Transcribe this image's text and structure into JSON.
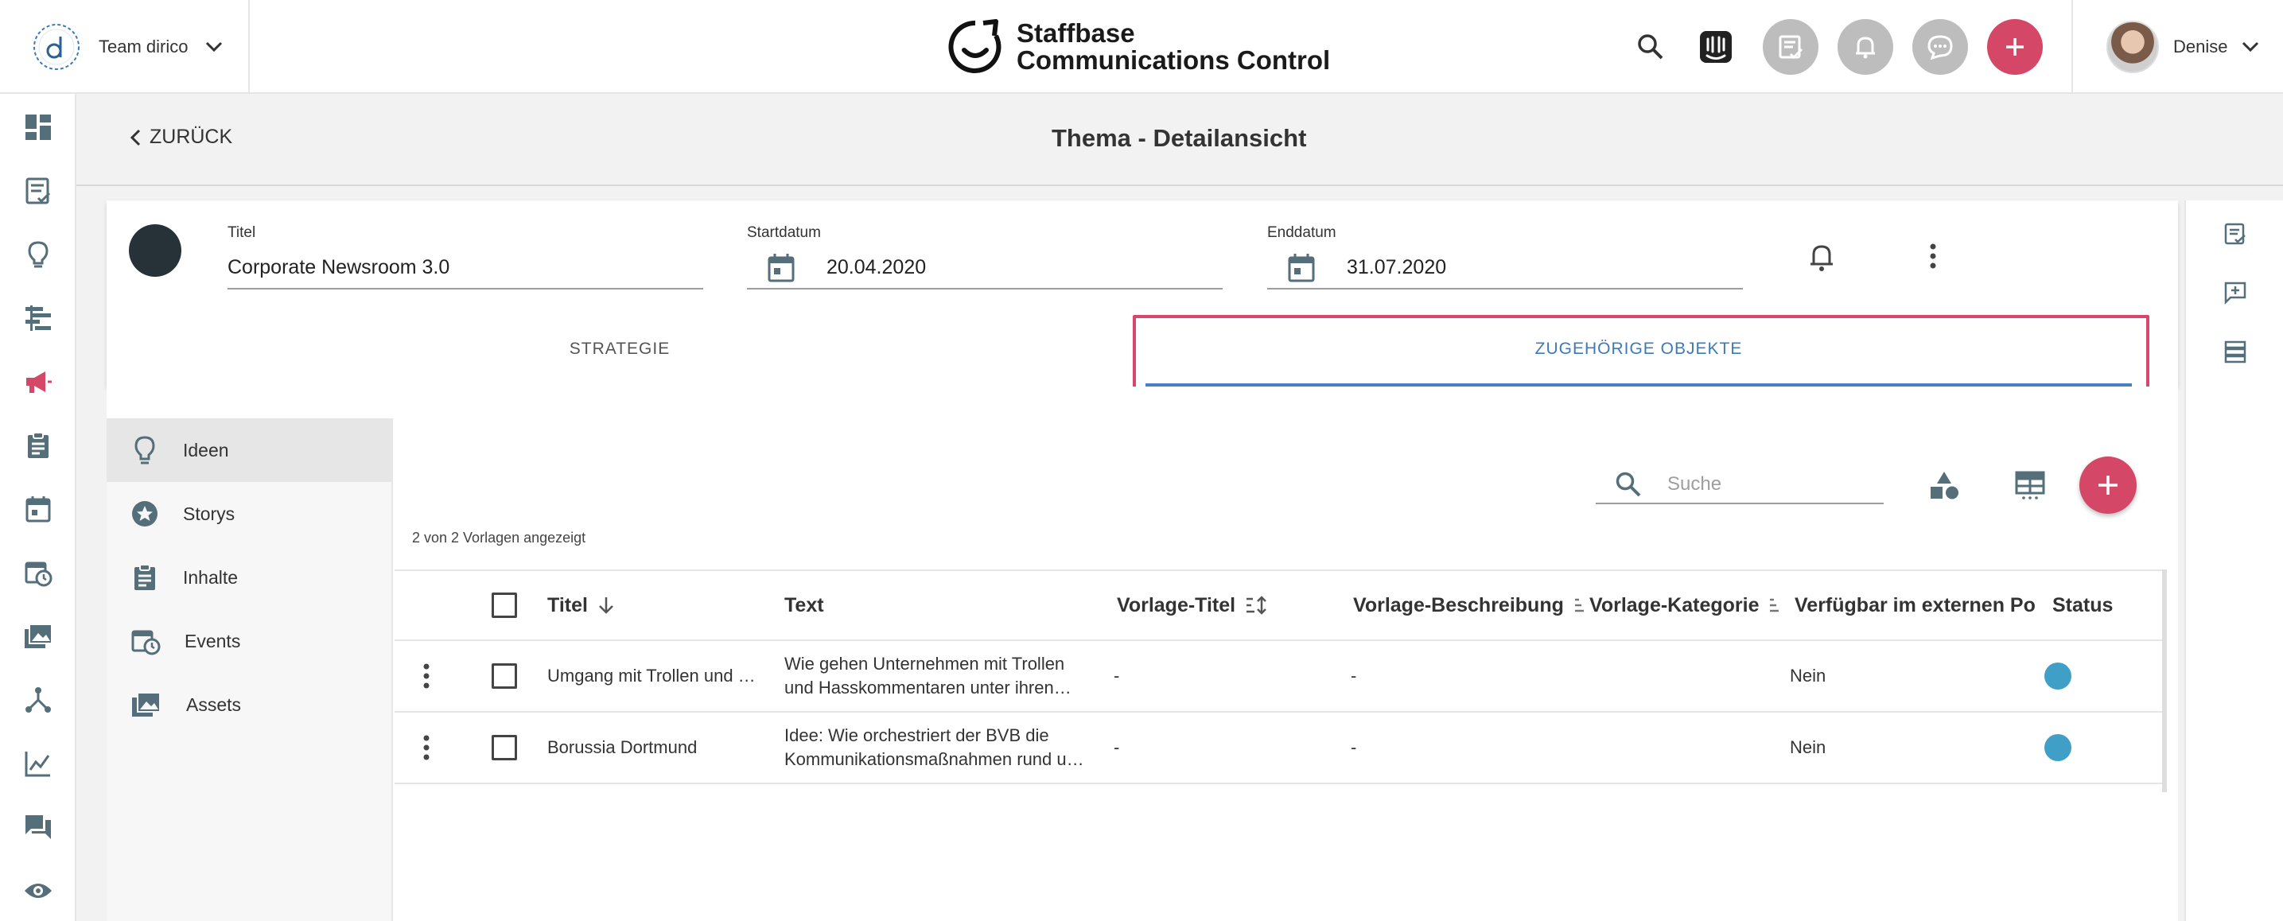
{
  "team": {
    "name": "Team dirico"
  },
  "brand": {
    "line1": "Staffbase",
    "line2": "Communications Control"
  },
  "user": {
    "name": "Denise"
  },
  "colors": {
    "accent": "#d44766",
    "link": "#3d7ab7",
    "status": "#3f9fc6"
  },
  "top_actions": [
    "search-icon",
    "intercom-icon",
    "approval-icon",
    "bell-icon",
    "chat-icon",
    "plus-icon"
  ],
  "left_rail": [
    "dashboard-icon",
    "checklist-icon",
    "lightbulb-icon",
    "timeline-icon",
    "campaign-icon",
    "clipboard-icon",
    "calendar-icon",
    "event-icon",
    "photos-icon",
    "hub-icon",
    "chart-icon",
    "forum-icon",
    "eye-icon"
  ],
  "subheader": {
    "back_label": "ZURÜCK",
    "title": "Thema - Detailansicht"
  },
  "detail": {
    "title_label": "Titel",
    "title_value": "Corporate Newsroom 3.0",
    "start_label": "Startdatum",
    "start_value": "20.04.2020",
    "end_label": "Enddatum",
    "end_value": "31.07.2020"
  },
  "tabs": {
    "strategy": "STRATEGIE",
    "related": "ZUGEHÖRIGE OBJEKTE"
  },
  "side_nav": {
    "ideas": "Ideen",
    "stories": "Storys",
    "content": "Inhalte",
    "events": "Events",
    "assets": "Assets"
  },
  "search": {
    "placeholder": "Suche"
  },
  "count_text": "2 von 2 Vorlagen angezeigt",
  "table": {
    "headers": {
      "title": "Titel",
      "text": "Text",
      "template_title": "Vorlage-Titel",
      "template_desc": "Vorlage-Beschreibung",
      "template_cat": "Vorlage-Kategorie",
      "external": "Verfügbar im externen Por",
      "status": "Status"
    },
    "rows": [
      {
        "title": "Umgang mit Trollen und …",
        "text_line1": "Wie gehen Unternehmen mit Trollen",
        "text_line2": "und Hasskommentaren unter ihren…",
        "template_title": "-",
        "template_desc": "-",
        "external": "Nein"
      },
      {
        "title": "Borussia Dortmund",
        "text_line1": "Idee:  Wie orchestriert der BVB die",
        "text_line2": "Kommunikationsmaßnahmen rund u…",
        "template_title": "-",
        "template_desc": "-",
        "external": "Nein"
      }
    ]
  }
}
